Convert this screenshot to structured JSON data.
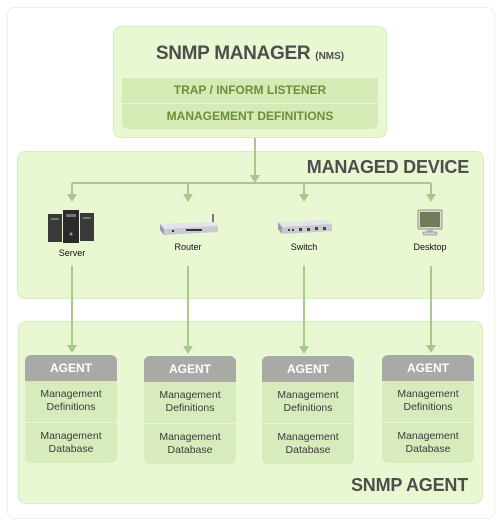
{
  "manager": {
    "title": "SNMP MANAGER",
    "title_suffix": "(NMS)",
    "rows": [
      "TRAP / INFORM LISTENER",
      "MANAGEMENT DEFINITIONS"
    ]
  },
  "managed_device": {
    "label": "MANAGED DEVICE",
    "devices": [
      {
        "name": "Server",
        "icon": "server-icon"
      },
      {
        "name": "Router",
        "icon": "router-icon"
      },
      {
        "name": "Switch",
        "icon": "switch-icon"
      },
      {
        "name": "Desktop",
        "icon": "desktop-icon"
      }
    ]
  },
  "snmp_agent": {
    "label": "SNMP AGENT",
    "agents": [
      {
        "title": "AGENT",
        "definitions": "Management Definitions",
        "database": "Management Database"
      },
      {
        "title": "AGENT",
        "definitions": "Management Definitions",
        "database": "Management Database"
      },
      {
        "title": "AGENT",
        "definitions": "Management Definitions",
        "database": "Management Database"
      },
      {
        "title": "AGENT",
        "definitions": "Management Definitions",
        "database": "Management Database"
      }
    ]
  },
  "colors": {
    "panel_fill": "#e9f7d3",
    "row_fill": "#d6eab6",
    "row_text": "#6b8f3a",
    "heading_text": "#4b4f4b",
    "agent_header": "#a9aaa6",
    "connector": "#a8c98a"
  }
}
